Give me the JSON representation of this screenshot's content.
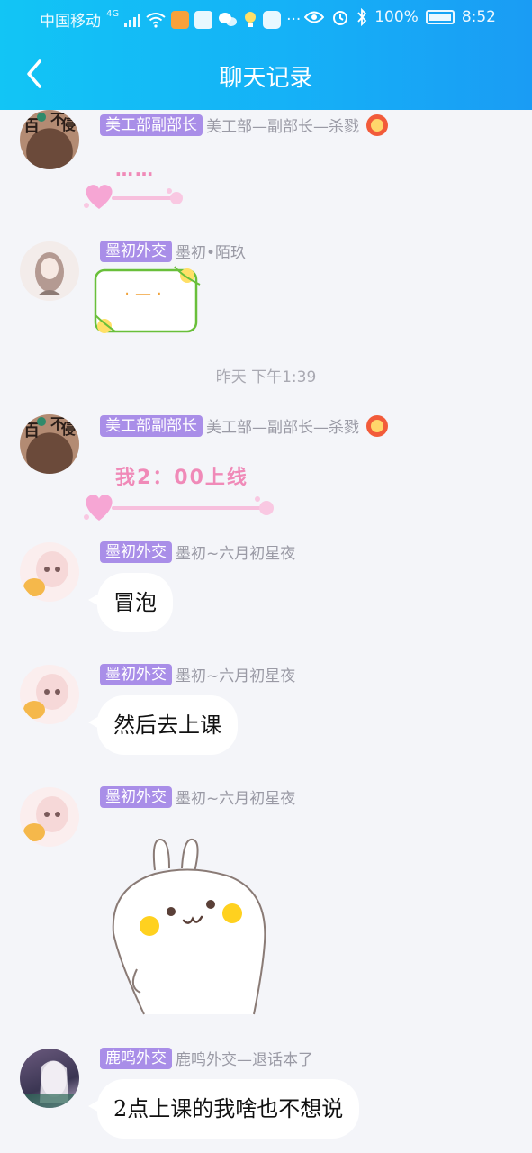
{
  "status_bar": {
    "carrier": "中国移动",
    "network": "4G",
    "more": "···",
    "battery": "100%",
    "time": "8:52"
  },
  "nav": {
    "title": "聊天记录"
  },
  "messages": [
    {
      "tag": "美工部副部长",
      "nick": "美工部—副部长—杀戮",
      "pink_text": "……"
    },
    {
      "tag": "墨初外交",
      "nick": "墨初•陌玖",
      "frame_text": "·—·"
    },
    {
      "timestamp": "昨天 下午1:39"
    },
    {
      "tag": "美工部副部长",
      "nick": "美工部—副部长—杀戮",
      "pink_text": "我2：00上线"
    },
    {
      "tag": "墨初外交",
      "nick": "墨初~六月初星夜",
      "text": "冒泡"
    },
    {
      "tag": "墨初外交",
      "nick": "墨初~六月初星夜",
      "text": "然后去上课"
    },
    {
      "tag": "墨初外交",
      "nick": "墨初~六月初星夜"
    },
    {
      "tag": "鹿鸣外交",
      "nick": "鹿鸣外交—退话本了",
      "text": "2点上课的我啥也不想说"
    }
  ],
  "colors": {
    "nav_bg": "#15b1f7",
    "page_bg": "#f4f5f9",
    "tag_bg": "#a98ee8",
    "pink_text": "#f08ab8"
  }
}
